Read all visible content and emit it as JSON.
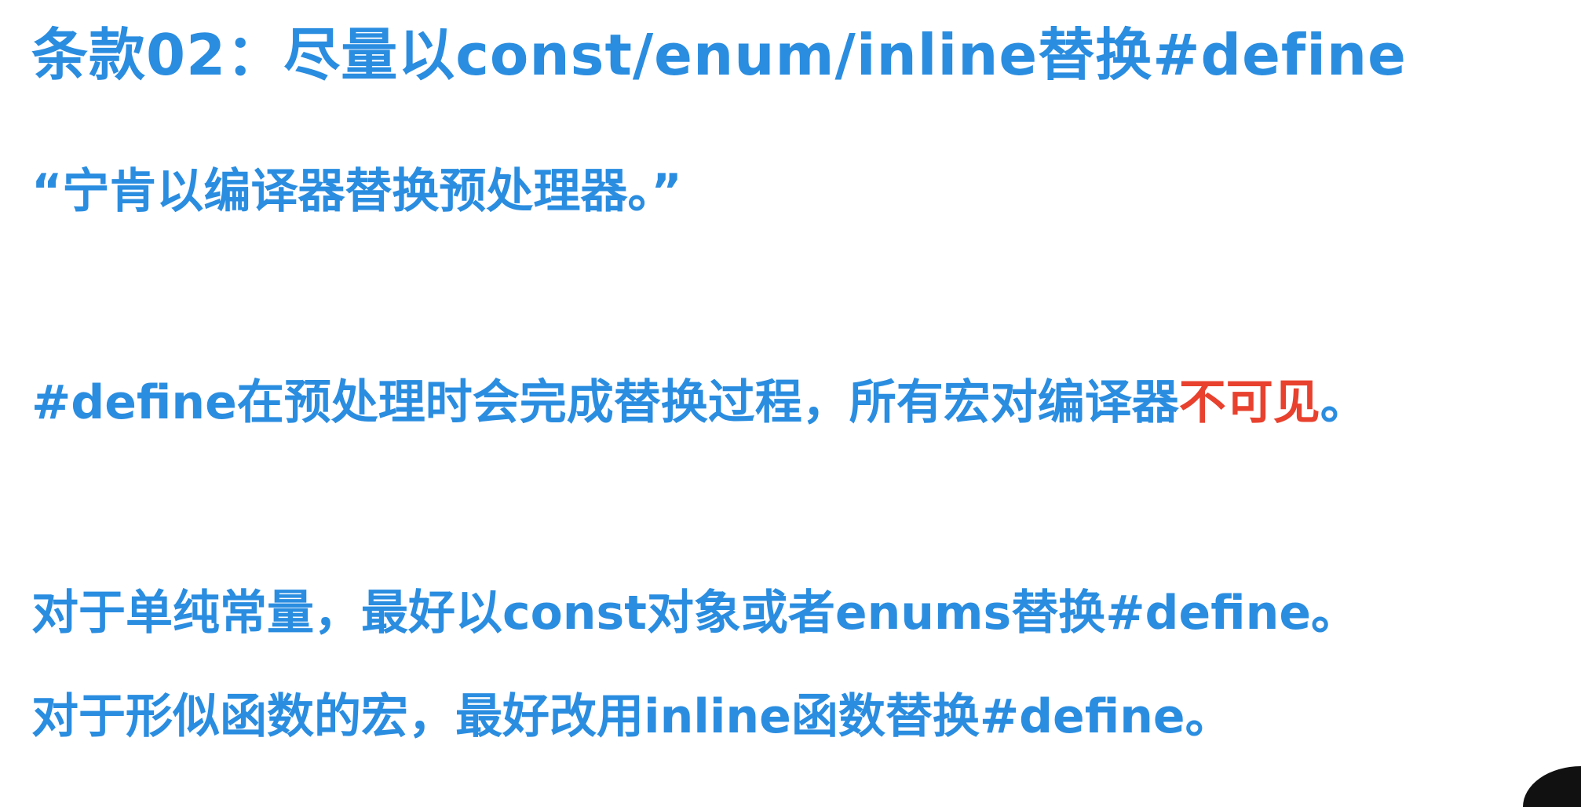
{
  "slide": {
    "title": "条款02：尽量以const/enum/inline替换#define",
    "quote": "“宁肯以编译器替换预处理器。”",
    "line1_main": "#define在预处理时会完成替换过程，所有宏对编译器",
    "line1_highlight": "不可见",
    "line1_end": "。",
    "line2": "对于单纯常量，最好以const对象或者enums替换#define。",
    "line3": "对于形似函数的宏，最好改用inline函数替换#define。"
  },
  "colors": {
    "text_blue": "#2a8de0",
    "highlight_red": "#e8412e",
    "background": "#ffffff"
  }
}
